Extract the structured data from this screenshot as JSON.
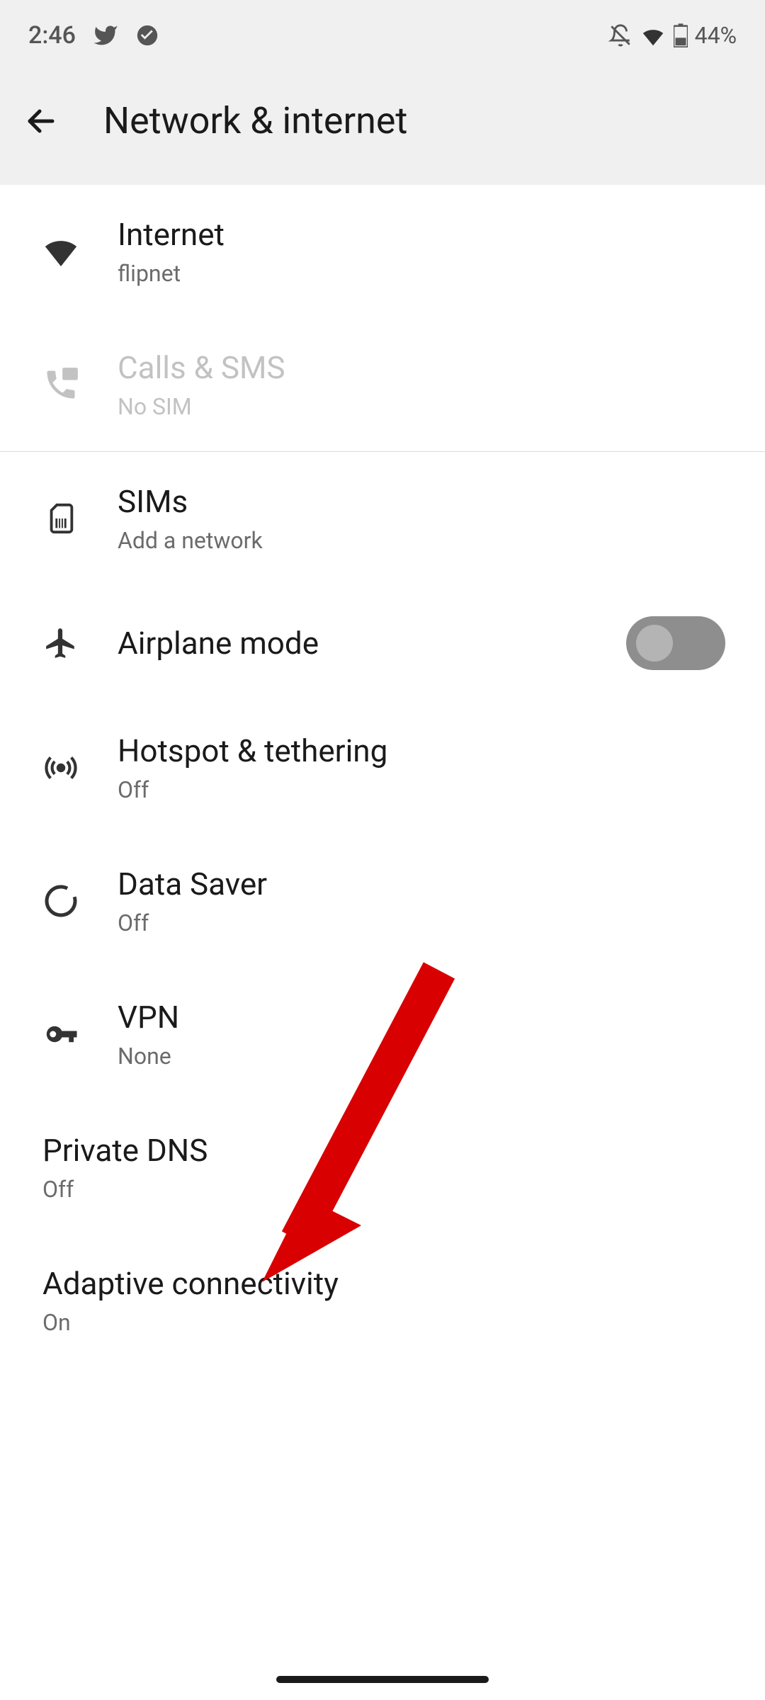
{
  "status_bar": {
    "time": "2:46",
    "battery": "44%"
  },
  "header": {
    "title": "Network & internet"
  },
  "rows": {
    "internet": {
      "title": "Internet",
      "sub": "flipnet"
    },
    "calls": {
      "title": "Calls & SMS",
      "sub": "No SIM"
    },
    "sims": {
      "title": "SIMs",
      "sub": "Add a network"
    },
    "airplane": {
      "title": "Airplane mode"
    },
    "hotspot": {
      "title": "Hotspot & tethering",
      "sub": "Off"
    },
    "datasaver": {
      "title": "Data Saver",
      "sub": "Off"
    },
    "vpn": {
      "title": "VPN",
      "sub": "None"
    },
    "privatedns": {
      "title": "Private DNS",
      "sub": "Off"
    },
    "adaptive": {
      "title": "Adaptive connectivity",
      "sub": "On"
    }
  },
  "toggles": {
    "airplane": false
  }
}
